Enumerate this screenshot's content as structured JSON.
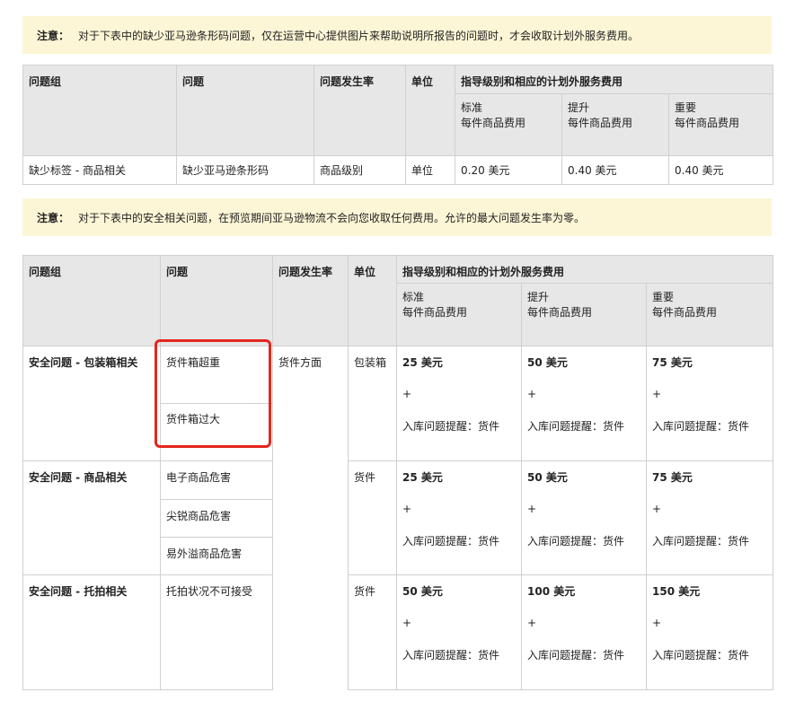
{
  "notice1": {
    "label": "注意：",
    "text": "对于下表中的缺少亚马逊条形码问题，仅在运营中心提供图片来帮助说明所报告的问题时，才会收取计划外服务费用。"
  },
  "table1": {
    "headers": {
      "group": "问题组",
      "issue": "问题",
      "rate": "问题发生率",
      "unit": "单位",
      "fees": "指导级别和相应的计划外服务费用"
    },
    "levels": [
      {
        "name": "标准",
        "sub": "每件商品费用"
      },
      {
        "name": "提升",
        "sub": "每件商品费用"
      },
      {
        "name": "重要",
        "sub": "每件商品费用"
      }
    ],
    "row": {
      "group": "缺少标签 - 商品相关",
      "issue": "缺少亚马逊条形码",
      "rate": "商品级别",
      "unit": "单位",
      "fees": [
        "0.20 美元",
        "0.40 美元",
        "0.40 美元"
      ]
    }
  },
  "notice2": {
    "label": "注意：",
    "text": "对于下表中的安全相关问题，在预览期间亚马逊物流不会向您收取任何费用。允许的最大问题发生率为零。"
  },
  "table2": {
    "headers": {
      "group": "问题组",
      "issue": "问题",
      "rate": "问题发生率",
      "unit": "单位",
      "fees": "指导级别和相应的计划外服务费用"
    },
    "levels": [
      {
        "name": "标准",
        "sub": "每件商品费用"
      },
      {
        "name": "提升",
        "sub": "每件商品费用"
      },
      {
        "name": "重要",
        "sub": "每件商品费用"
      }
    ],
    "rate_all": "货件方面",
    "plus": "+",
    "alert": "入库问题提醒：货件",
    "rows": [
      {
        "group": "安全问题 - 包装箱相关",
        "issues": [
          "货件箱超重",
          "货件箱过大"
        ],
        "unit": "包装箱",
        "fees": [
          "25 美元",
          "50 美元",
          "75 美元"
        ]
      },
      {
        "group": "安全问题 - 商品相关",
        "issues": [
          "电子商品危害",
          "尖锐商品危害",
          "易外溢商品危害"
        ],
        "unit": "货件",
        "fees": [
          "25 美元",
          "50 美元",
          "75 美元"
        ]
      },
      {
        "group": "安全问题 - 托拍相关",
        "issues": [
          "托拍状况不可接受"
        ],
        "unit": "货件",
        "fees": [
          "50 美元",
          "100 美元",
          "150 美元"
        ]
      }
    ]
  }
}
